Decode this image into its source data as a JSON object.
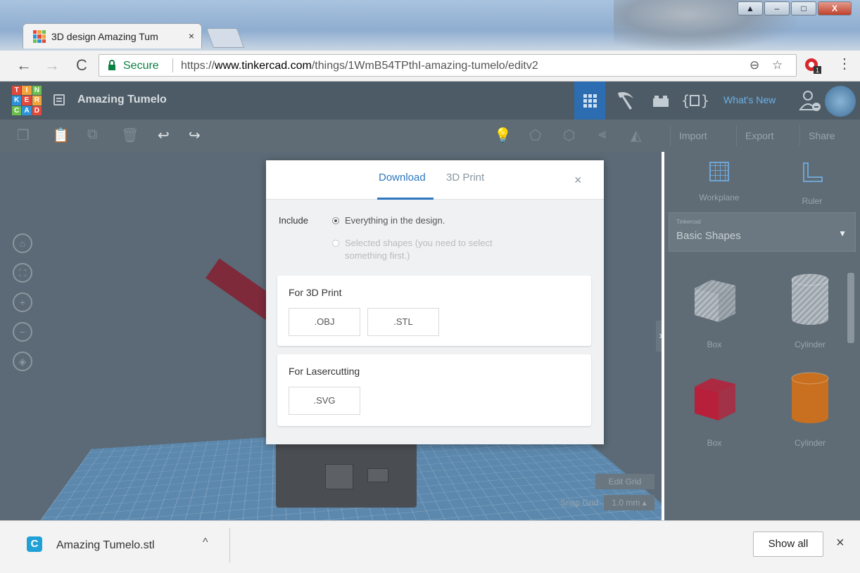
{
  "browser": {
    "tab_title": "3D design Amazing Tum",
    "tab_close": "×",
    "secure_label": "Secure",
    "url_scheme": "https://",
    "url_host": "www.tinkercad.com",
    "url_path": "/things/1WmB54TPthI-amazing-tumelo/editv2",
    "ext_badge": "1",
    "win_minimize": "–",
    "win_maximize": "□",
    "win_close": "X"
  },
  "tinkercad": {
    "logo_letters": [
      "T",
      "I",
      "N",
      "K",
      "E",
      "R",
      "C",
      "A",
      "D"
    ],
    "logo_colors": [
      "#e3493b",
      "#f3a33b",
      "#6cbf4c",
      "#2c93d8",
      "#e3493b",
      "#f3a33b",
      "#6cbf4c",
      "#2c93d8",
      "#e3493b"
    ],
    "design_title": "Amazing Tumelo",
    "whats_new": "What's New",
    "toolbar": {
      "import": "Import",
      "export": "Export",
      "share": "Share"
    }
  },
  "right_panel": {
    "workplane_label": "Workplane",
    "ruler_label": "Ruler",
    "library_small": "Tinkercad",
    "library_name": "Basic Shapes",
    "shapes": [
      {
        "name": "Box",
        "color": "#9aa3ab",
        "kind": "box-hole"
      },
      {
        "name": "Cylinder",
        "color": "#9aa3ab",
        "kind": "cyl-hole"
      },
      {
        "name": "Box",
        "color": "#b81f3a",
        "kind": "box"
      },
      {
        "name": "Cylinder",
        "color": "#c8701f",
        "kind": "cyl"
      }
    ]
  },
  "workplane": {
    "edit_grid": "Edit Grid",
    "snap_grid_label": "Snap Grid",
    "snap_grid_value": "1.0 mm ▴"
  },
  "modal": {
    "tab_download": "Download",
    "tab_print": "3D Print",
    "close": "×",
    "include_label": "Include",
    "option_everything": "Everything in the design.",
    "option_selected": "Selected shapes (you need to select something first.)",
    "print_title": "For 3D Print",
    "obj_button": ".OBJ",
    "stl_button": ".STL",
    "laser_title": "For Lasercutting",
    "svg_button": ".SVG"
  },
  "download_bar": {
    "file_name": "Amazing Tumelo.stl",
    "show_all": "Show all",
    "close": "×"
  }
}
